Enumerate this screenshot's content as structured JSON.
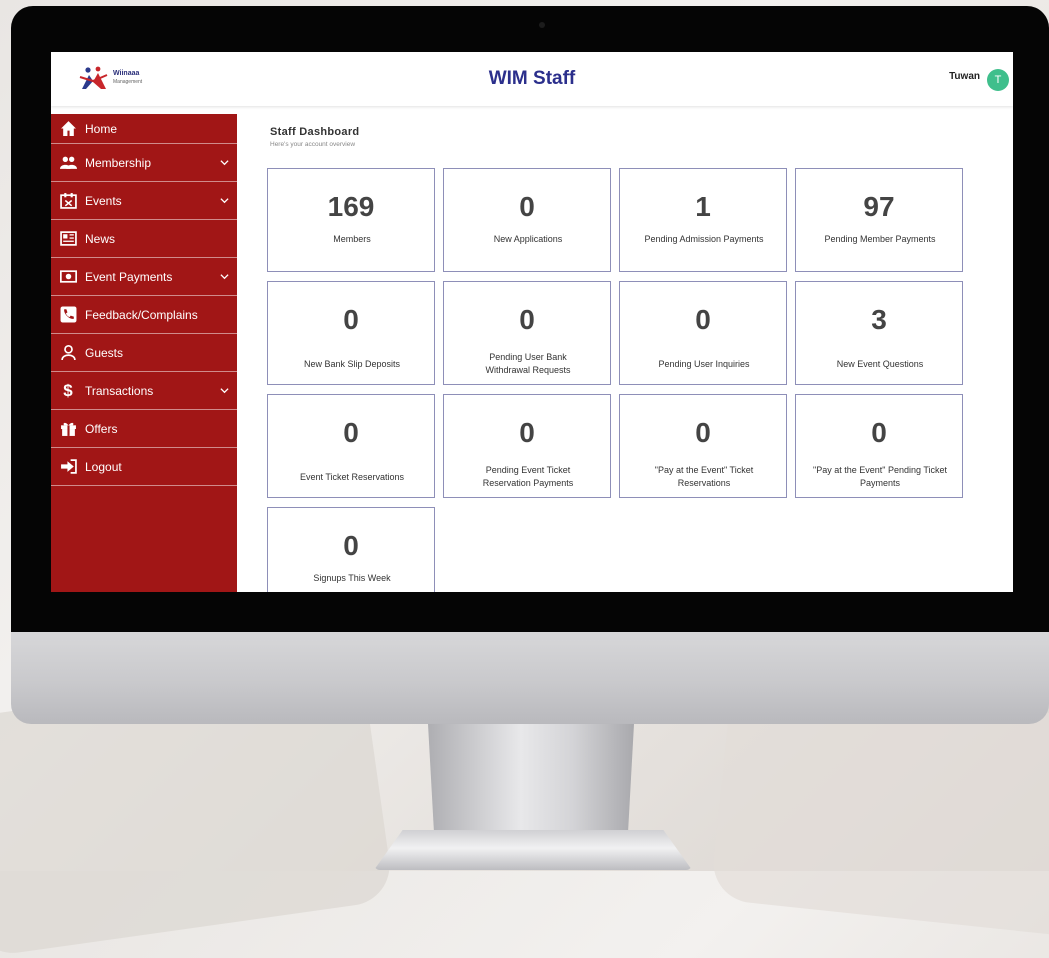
{
  "app": {
    "title": "WIM Staff",
    "logo_text": "Wiinaaa",
    "logo_subtext": "Management"
  },
  "user": {
    "name": "Tuwan",
    "initial": "T"
  },
  "sidebar": {
    "items": [
      {
        "label": "Home",
        "icon": "home-icon"
      },
      {
        "label": "Membership",
        "icon": "users-icon",
        "expandable": true
      },
      {
        "label": "Events",
        "icon": "calendar-icon",
        "expandable": true
      },
      {
        "label": "News",
        "icon": "newspaper-icon"
      },
      {
        "label": "Event Payments",
        "icon": "money-icon",
        "expandable": true
      },
      {
        "label": "Feedback/Complains",
        "icon": "phone-icon"
      },
      {
        "label": "Guests",
        "icon": "user-outline-icon"
      },
      {
        "label": "Transactions",
        "icon": "dollar-icon",
        "expandable": true
      },
      {
        "label": "Offers",
        "icon": "gift-icon"
      },
      {
        "label": "Logout",
        "icon": "logout-icon"
      }
    ]
  },
  "main": {
    "title": "Staff Dashboard",
    "subtitle": "Here's your account overview",
    "cards": [
      {
        "value": "169",
        "label": "Members"
      },
      {
        "value": "0",
        "label": "New Applications"
      },
      {
        "value": "1",
        "label": "Pending Admission Payments"
      },
      {
        "value": "97",
        "label": "Pending Member Payments"
      },
      {
        "value": "0",
        "label": "New Bank Slip Deposits"
      },
      {
        "value": "0",
        "label": "Pending User Bank Withdrawal Requests"
      },
      {
        "value": "0",
        "label": "Pending User Inquiries"
      },
      {
        "value": "3",
        "label": "New Event Questions"
      },
      {
        "value": "0",
        "label": "Event Ticket Reservations"
      },
      {
        "value": "0",
        "label": "Pending Event Ticket Reservation Payments"
      },
      {
        "value": "0",
        "label": "\"Pay at the Event\" Ticket Reservations"
      },
      {
        "value": "0",
        "label": "\"Pay at the Event\" Pending Ticket Payments"
      },
      {
        "value": "0",
        "label": "Signups This Week"
      }
    ]
  },
  "colors": {
    "sidebar": "#a11616",
    "title": "#2b2f8c",
    "avatar": "#3fbf8c",
    "card_border": "#8e8fb8"
  }
}
